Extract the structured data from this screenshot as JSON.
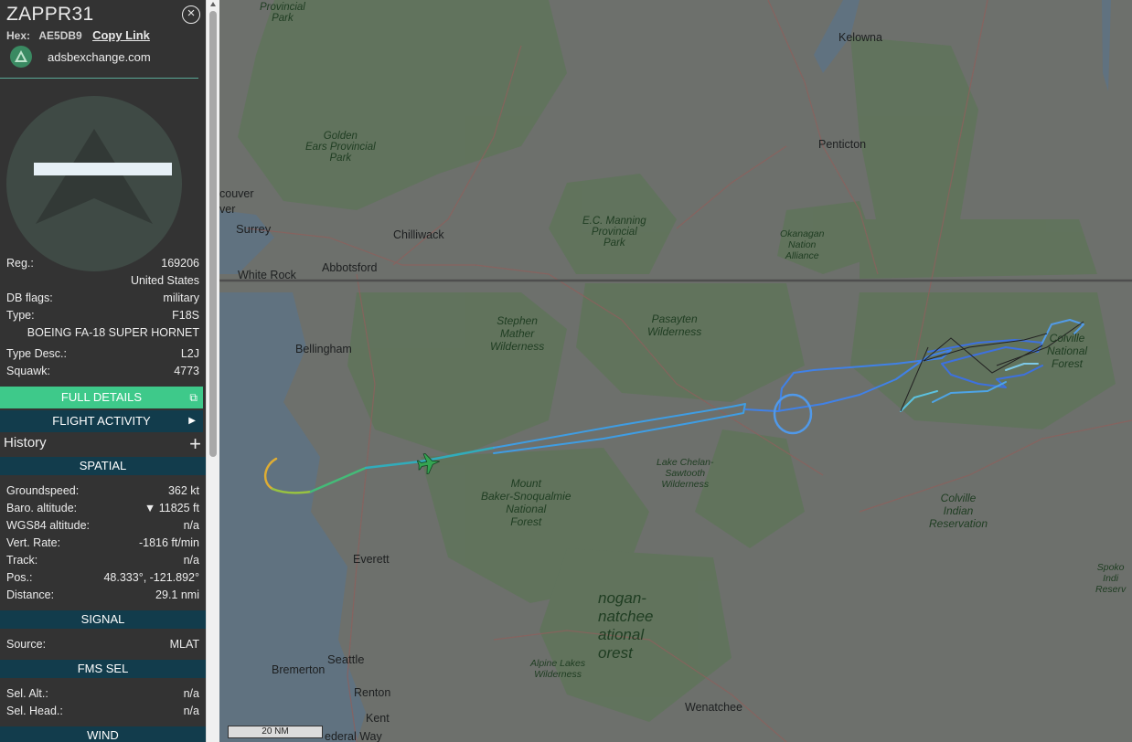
{
  "header": {
    "callsign": "ZAPPR31",
    "hex_label": "Hex:",
    "hex_value": "AE5DB9",
    "copy_link": "Copy Link",
    "source_site": "adsbexchange.com",
    "close_icon": "close-icon"
  },
  "aircraft": {
    "reg_label": "Reg.:",
    "reg_value": "169206",
    "country": "United States",
    "dbflags_label": "DB flags:",
    "dbflags_value": "military",
    "type_label": "Type:",
    "type_value": "F18S",
    "type_full": "BOEING FA-18 SUPER HORNET",
    "typedesc_label": "Type Desc.:",
    "typedesc_value": "L2J",
    "squawk_label": "Squawk:",
    "squawk_value": "4773"
  },
  "buttons": {
    "full_details": "FULL DETAILS",
    "flight_activity": "FLIGHT ACTIVITY",
    "history": "History"
  },
  "spatial": {
    "title": "SPATIAL",
    "groundspeed_label": "Groundspeed:",
    "groundspeed_value": "362 kt",
    "baro_label": "Baro. altitude:",
    "baro_value": "▼ 11825 ft",
    "wgs_label": "WGS84 altitude:",
    "wgs_value": "n/a",
    "vrate_label": "Vert. Rate:",
    "vrate_value": "-1816 ft/min",
    "track_label": "Track:",
    "track_value": "n/a",
    "pos_label": "Pos.:",
    "pos_value": "48.333°, -121.892°",
    "distance_label": "Distance:",
    "distance_value": "29.1 nmi"
  },
  "signal": {
    "title": "SIGNAL",
    "source_label": "Source:",
    "source_value": "MLAT"
  },
  "fms": {
    "title": "FMS SEL",
    "alt_label": "Sel. Alt.:",
    "alt_value": "n/a",
    "head_label": "Sel. Head.:",
    "head_value": "n/a"
  },
  "wind": {
    "title": "WIND"
  },
  "map": {
    "scale": "20 NM",
    "labels": {
      "kelowna": "Kelowna",
      "penticton": "Penticton",
      "surrey": "Surrey",
      "chilliwack": "Chilliwack",
      "white_rock": "White Rock",
      "abbotsford": "Abbotsford",
      "bellingham": "Bellingham",
      "everett": "Everett",
      "seattle": "Seattle",
      "bremerton": "Bremerton",
      "renton": "Renton",
      "kent": "Kent",
      "federal_way": "ederal Way",
      "wenatchee": "Wenatchee",
      "couver": "couver",
      "ver": "ver",
      "provincial_park_top": "Provincial\nPark",
      "golden_ears": "Golden\nEars Provincial\nPark",
      "ec_manning": "E.C. Manning\nProvincial\nPark",
      "okanagan_nation": "Okanagan\nNation\nAlliance",
      "stephen_mather": "Stephen\nMather\nWilderness",
      "pasayten": "Pasayten\nWilderness",
      "colville_nf": "Colville\nNational\nForest",
      "lake_chelan": "Lake Chelan-\nSawtooth\nWilderness",
      "mt_baker": "Mount\nBaker-Snoqualmie\nNational\nForest",
      "colville_ir": "Colville\nIndian\nReservation",
      "okanogan_wenatchee": "nogan-\nnatchee\national\norest",
      "alpine_lakes": "Alpine Lakes\nWilderness",
      "spokane": "Spoko\nIndi\nReserv"
    }
  },
  "colors": {
    "sidebar_bg": "#333333",
    "section_bg": "#123c4c",
    "full_details_bg": "#3ec98a",
    "track_blue": "#3b82f0",
    "aircraft_icon": "#2fa84f"
  }
}
